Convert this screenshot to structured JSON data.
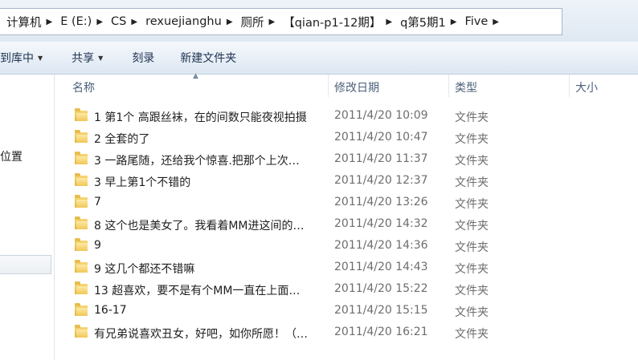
{
  "address": {
    "crumbs": [
      "计算机",
      "E (E:)",
      "CS",
      "rexuejianghu",
      "厕所",
      "【qian-p1-12期】",
      "q第5期1",
      "Five"
    ]
  },
  "toolbar": {
    "include_library_label": "到库中",
    "share_label": "共享",
    "burn_label": "刻录",
    "new_folder_label": "新建文件夹"
  },
  "nav": {
    "location_label": "位置"
  },
  "columns": {
    "name": "名称",
    "date": "修改日期",
    "type": "类型",
    "size": "大小"
  },
  "files": [
    {
      "name": "1 第1个 高跟丝袜，在的间数只能夜视拍摄",
      "date": "2011/4/20 10:09",
      "type": "文件夹"
    },
    {
      "name": "2 全套的了",
      "date": "2011/4/20 10:47",
      "type": "文件夹"
    },
    {
      "name": "3 一路尾随，还给我个惊喜.把那个上次…",
      "date": "2011/4/20 11:37",
      "type": "文件夹"
    },
    {
      "name": "3 早上第1个不错的",
      "date": "2011/4/20 12:37",
      "type": "文件夹"
    },
    {
      "name": "7",
      "date": "2011/4/20 13:26",
      "type": "文件夹"
    },
    {
      "name": "8 这个也是美女了。我看着MM进这间的…",
      "date": "2011/4/20 14:32",
      "type": "文件夹"
    },
    {
      "name": "9",
      "date": "2011/4/20 14:36",
      "type": "文件夹"
    },
    {
      "name": "9 这几个都还不错嘛",
      "date": "2011/4/20 14:43",
      "type": "文件夹"
    },
    {
      "name": "13 超喜欢，要不是有个MM一直在上面…",
      "date": "2011/4/20 15:22",
      "type": "文件夹"
    },
    {
      "name": "16-17",
      "date": "2011/4/20 15:15",
      "type": "文件夹"
    },
    {
      "name": "有兄弟说喜欢丑女，好吧，如你所愿！（…",
      "date": "2011/4/20 16:21",
      "type": "文件夹"
    }
  ]
}
